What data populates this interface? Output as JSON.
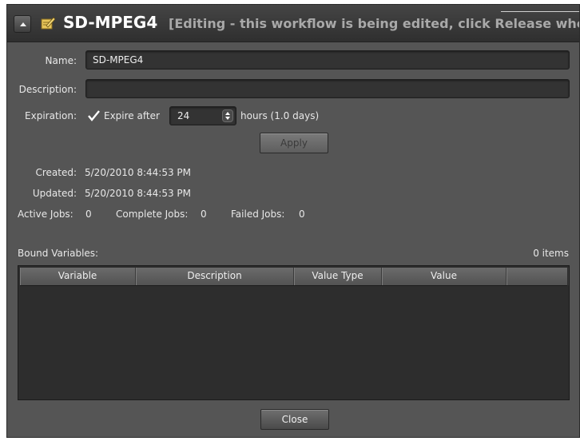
{
  "window": {
    "title": "SD-MPEG4",
    "status": "[Editing - this workflow is being edited, click Release whe"
  },
  "form": {
    "name_label": "Name:",
    "name_value": "SD-MPEG4",
    "description_label": "Description:",
    "description_value": "",
    "expiration_label": "Expiration:",
    "expire_checked": true,
    "expire_checkbox_label": "Expire after",
    "expire_hours": "24",
    "expire_suffix": "hours (1.0 days)",
    "apply_label": "Apply"
  },
  "info": {
    "created_label": "Created:",
    "created_value": "5/20/2010 8:44:53 PM",
    "updated_label": "Updated:",
    "updated_value": "5/20/2010 8:44:53 PM",
    "active_jobs_label": "Active Jobs:",
    "active_jobs_value": "0",
    "complete_jobs_label": "Complete Jobs:",
    "complete_jobs_value": "0",
    "failed_jobs_label": "Failed Jobs:",
    "failed_jobs_value": "0"
  },
  "bound_variables": {
    "label": "Bound Variables:",
    "count": "0 items",
    "columns": [
      "Variable",
      "Description",
      "Value Type",
      "Value",
      ""
    ],
    "rows": []
  },
  "footer": {
    "close_label": "Close"
  },
  "icons": {
    "collapse": "chevron-up-icon",
    "edit": "edit-pencil-icon",
    "check": "checkmark-icon",
    "spinner": "spinner-arrows-icon"
  },
  "colors": {
    "panel": "#555555",
    "titlebar": "#333333",
    "input": "#333333",
    "title_text": "#ffffff",
    "status_text": "#a9a9a9"
  }
}
